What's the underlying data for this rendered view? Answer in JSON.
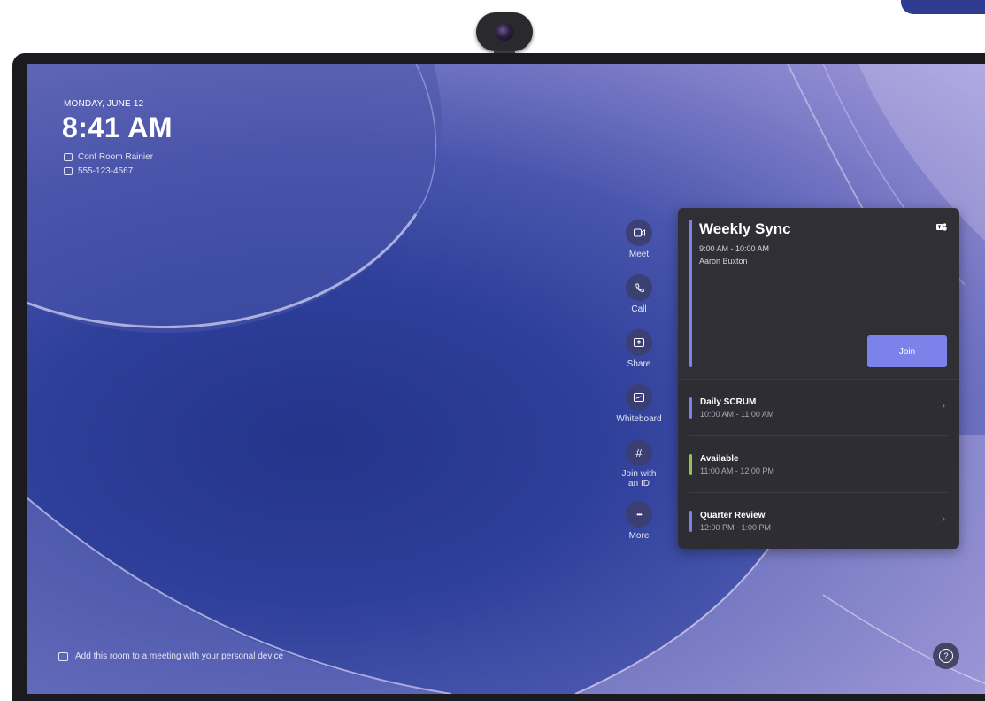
{
  "clock": {
    "date": "MONDAY, JUNE 12",
    "time": "8:41 AM"
  },
  "room": {
    "name": "Conf Room Rainier",
    "phone": "555-123-4567"
  },
  "actions": [
    {
      "label": "Meet",
      "icon": "video-camera-icon"
    },
    {
      "label": "Call",
      "icon": "phone-icon"
    },
    {
      "label": "Share",
      "icon": "share-screen-icon"
    },
    {
      "label": "Whiteboard",
      "icon": "whiteboard-icon"
    },
    {
      "label": "Join with\nan ID",
      "label_line1": "Join with",
      "label_line2": "an ID",
      "icon": "hash-icon",
      "glyph": "#"
    },
    {
      "label": "More",
      "icon": "more-icon",
      "glyph": "•••"
    }
  ],
  "current_meeting": {
    "title": "Weekly Sync",
    "time": "9:00 AM - 10:00 AM",
    "organizer": "Aaron Buxton",
    "join_label": "Join",
    "accent": "#7b83eb"
  },
  "upcoming": [
    {
      "title": "Daily SCRUM",
      "time": "10:00 AM - 11:00 AM",
      "accent": "#7b83eb",
      "has_chevron": true
    },
    {
      "title": "Available",
      "time": "11:00 AM - 12:00 PM",
      "accent": "#92c353",
      "has_chevron": false
    },
    {
      "title": "Quarter Review",
      "time": "12:00 PM - 1:00 PM",
      "accent": "#7b83eb",
      "has_chevron": true
    }
  ],
  "footer": {
    "hint": "Add this room to a meeting with your personal device",
    "help_glyph": "?"
  },
  "colors": {
    "accent": "#7b83eb",
    "available": "#92c353",
    "card_bg": "#2d2d33"
  }
}
